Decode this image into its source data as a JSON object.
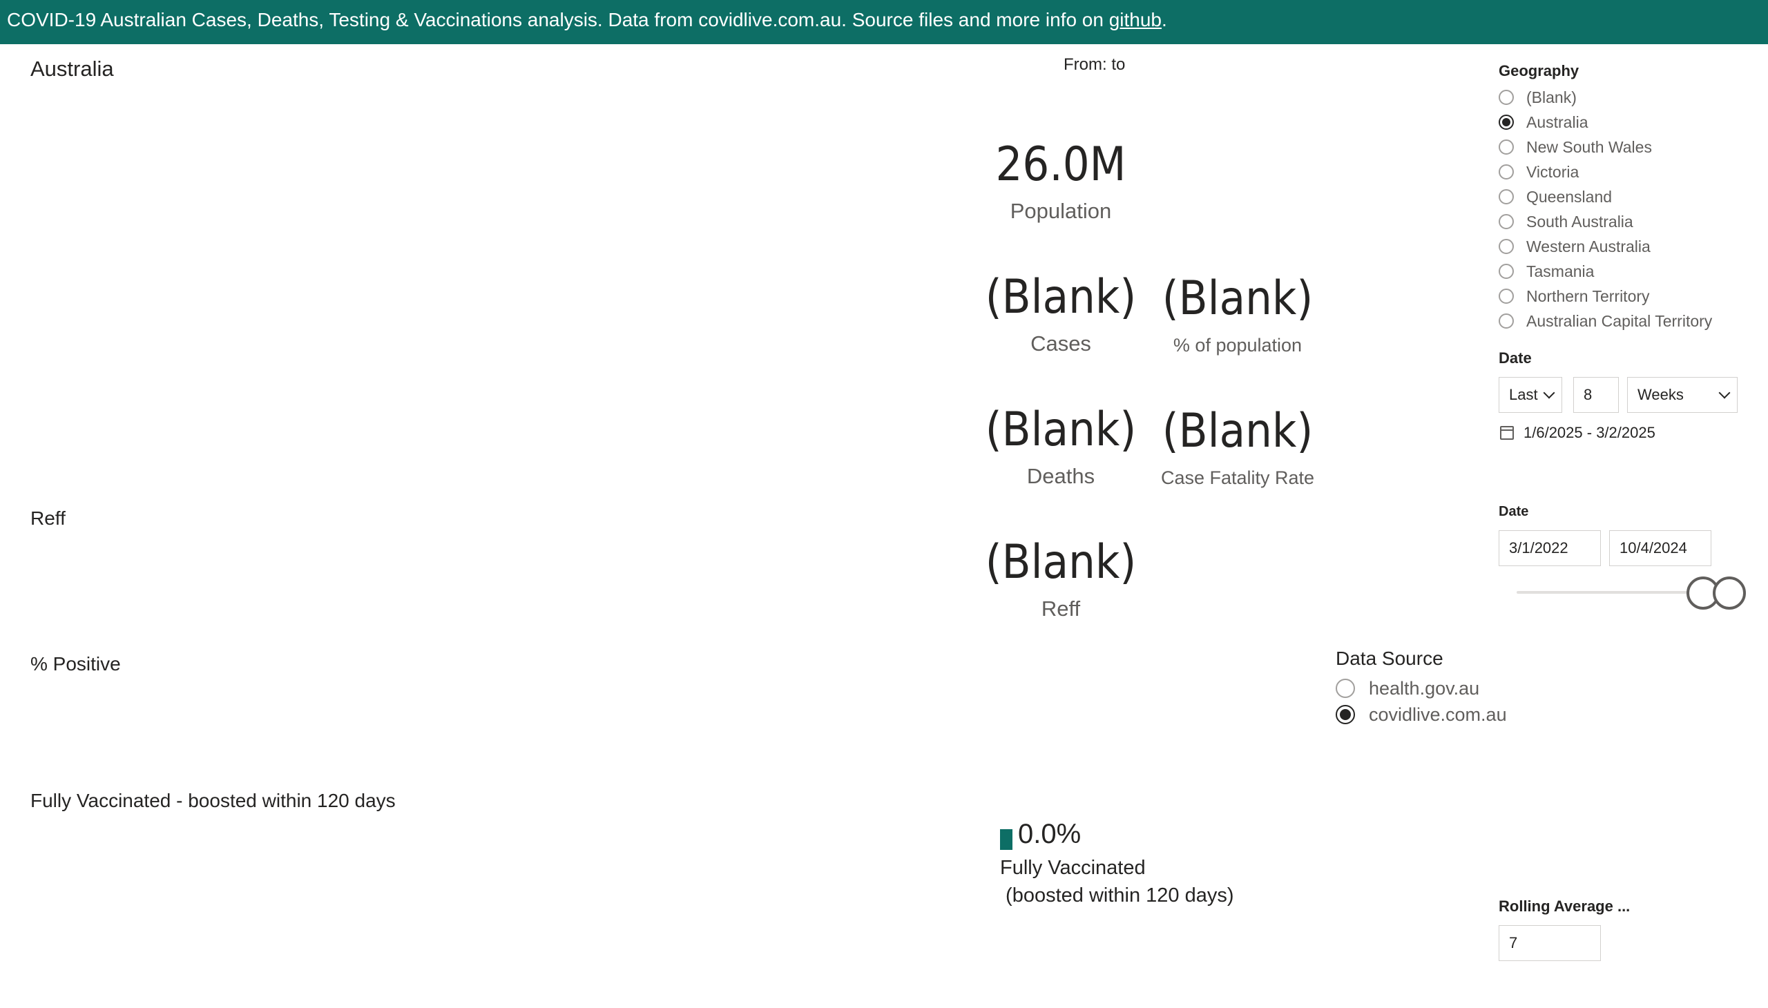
{
  "banner": {
    "text": "COVID-19 Australian Cases, Deaths, Testing & Vaccinations analysis. Data from covidlive.com.au. Source files and more info on ",
    "link": "github",
    "suffix": "."
  },
  "region_title": "Australia",
  "from_to": "From: to",
  "sections": {
    "reff": "Reff",
    "positive": "% Positive",
    "vaccinated": "Fully Vaccinated - boosted within 120 days"
  },
  "kpis": {
    "population": {
      "value": "26.0M",
      "label": "Population"
    },
    "cases": {
      "value": "(Blank)",
      "label": "Cases"
    },
    "pct_population": {
      "value": "(Blank)",
      "label": "% of population"
    },
    "deaths": {
      "value": "(Blank)",
      "label": "Deaths"
    },
    "cfr": {
      "value": "(Blank)",
      "label": "Case Fatality Rate"
    },
    "reff": {
      "value": "(Blank)",
      "label": "Reff"
    }
  },
  "geography": {
    "title": "Geography",
    "options": [
      {
        "label": "(Blank)",
        "checked": false
      },
      {
        "label": "Australia",
        "checked": true
      },
      {
        "label": "New South Wales",
        "checked": false
      },
      {
        "label": "Victoria",
        "checked": false
      },
      {
        "label": "Queensland",
        "checked": false
      },
      {
        "label": "South Australia",
        "checked": false
      },
      {
        "label": "Western Australia",
        "checked": false
      },
      {
        "label": "Tasmania",
        "checked": false
      },
      {
        "label": "Northern Territory",
        "checked": false
      },
      {
        "label": "Australian Capital Territory",
        "checked": false
      }
    ]
  },
  "date_relative": {
    "title": "Date",
    "mode": "Last",
    "count": "8",
    "unit": "Weeks",
    "range": "1/6/2025 - 3/2/2025"
  },
  "date_between": {
    "title": "Date",
    "start": "3/1/2022",
    "end": "10/4/2024"
  },
  "data_source": {
    "title": "Data Source",
    "options": [
      {
        "label": "health.gov.au",
        "checked": false
      },
      {
        "label": "covidlive.com.au",
        "checked": true
      }
    ]
  },
  "vaccination": {
    "value": "0.0%",
    "fraction": 0.0,
    "label": "Fully Vaccinated\n (boosted within 120 days)",
    "color": "#0d6e65"
  },
  "rolling_average": {
    "title": "Rolling Average ...",
    "value": "7"
  },
  "colors": {
    "accent": "#0d6e65"
  }
}
